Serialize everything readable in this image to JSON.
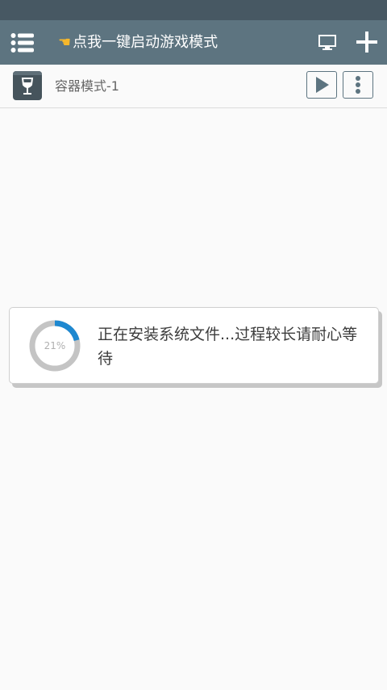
{
  "app_bar": {
    "title_prefix_icon": "pointing-hand-icon",
    "title": "点我一键启动游戏模式",
    "color": "#5d7480"
  },
  "status_bar": {
    "color": "#475863"
  },
  "container": {
    "name": "容器模式-1",
    "icon": "wine-glass-icon"
  },
  "dialog": {
    "progress": 21,
    "progress_label": "21%",
    "message": "正在安装系统文件...过程较长请耐心等待",
    "accent_color": "#1e88d0",
    "track_color": "#c4c4c4"
  }
}
